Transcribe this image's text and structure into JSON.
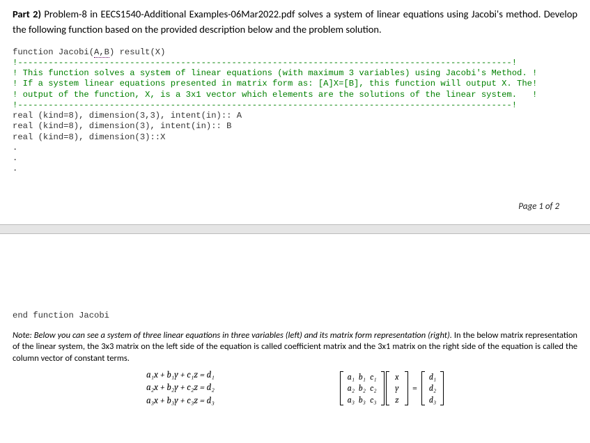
{
  "header": {
    "part_label": "Part 2)",
    "body": " Problem-8 in EECS1540-Additional Examples-06Mar2022.pdf solves a system of linear equations using Jacobi's method. Develop the following function based on the provided description below and the problem solution."
  },
  "code": {
    "sig_prefix": "function Jacobi(",
    "sig_args": "A,B",
    "sig_suffix": ") result(X)",
    "dash1": "!-------------------------------------------------------------------------------------------------!",
    "c1": "! This function solves a system of linear equations (with maximum 3 variables) using Jacobi's Method. !",
    "c2": "! If a system linear equations presented in matrix form as: [A]X=[B], this function will output X. The!",
    "c3": "! output of the function, X, is a 3x1 vector which elements are the solutions of the linear system.   !",
    "dash2": "!-------------------------------------------------------------------------------------------------!",
    "decl1": "real (kind=8), dimension(3,3), intent(in):: A",
    "decl2": "real (kind=8), dimension(3), intent(in):: B",
    "decl3": "real (kind=8), dimension(3)::X",
    "dot": ".",
    "end": "end function Jacobi"
  },
  "page_indicator": "Page 1 of 2",
  "note": {
    "italic_part": "Note: Below you can see a system of three linear equations in three variables (left) and its matrix form representation (right).",
    "rest": " In the below matrix representation of the linear system, the 3x3 matrix on the left side of the equation is called coefficient matrix and the 3x1 matrix on the right side of the equation is called the column vector of constant terms."
  },
  "equations": {
    "left": [
      "a₁x + b₁y + c₁z = d₁",
      "a₂x + b₂y + c₂z = d₂",
      "a₃x + b₃y + c₃z = d₃"
    ],
    "matrixA": [
      [
        "a₁",
        "b₁",
        "c₁"
      ],
      [
        "a₂",
        "b₂",
        "c₂"
      ],
      [
        "a₃",
        "b₃",
        "c₃"
      ]
    ],
    "vecX": [
      "x",
      "y",
      "z"
    ],
    "vecD": [
      "d₁",
      "d₂",
      "d₃"
    ],
    "eq": "="
  }
}
